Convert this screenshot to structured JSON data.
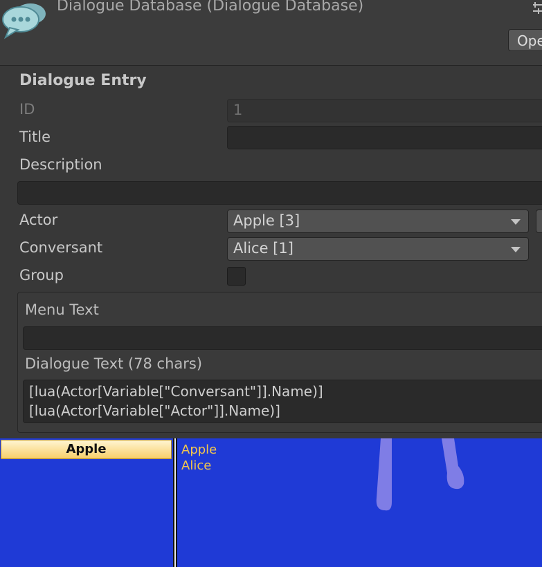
{
  "window": {
    "title": "Dialogue Database (Dialogue Database)",
    "open_button_label": "Ope"
  },
  "inspector": {
    "section_title": "Dialogue Entry",
    "id_label": "ID",
    "id_value": "1",
    "title_label": "Title",
    "title_value": "",
    "description_label": "Description",
    "description_value": "",
    "actor_label": "Actor",
    "actor_value": "Apple [3]",
    "conversant_label": "Conversant",
    "conversant_value": "Alice [1]",
    "group_label": "Group",
    "group_checked": false,
    "menu_text_label": "Menu Text",
    "menu_text_value": "",
    "dialogue_text_label": "Dialogue Text (78 chars)",
    "dialogue_text_lines": [
      "[lua(Actor[Variable[\"Conversant\"]].Name)]",
      "[lua(Actor[Variable[\"Actor\"]].Name)]"
    ]
  },
  "preview": {
    "actor_tab_label": "Apple",
    "lines": [
      "Apple",
      "Alice"
    ],
    "background_color": "#1f3ad6",
    "text_color": "#f3c64d"
  },
  "icons": [
    "speech-bubbles-logo-icon",
    "tune-icon",
    "chevron-down-icon"
  ]
}
